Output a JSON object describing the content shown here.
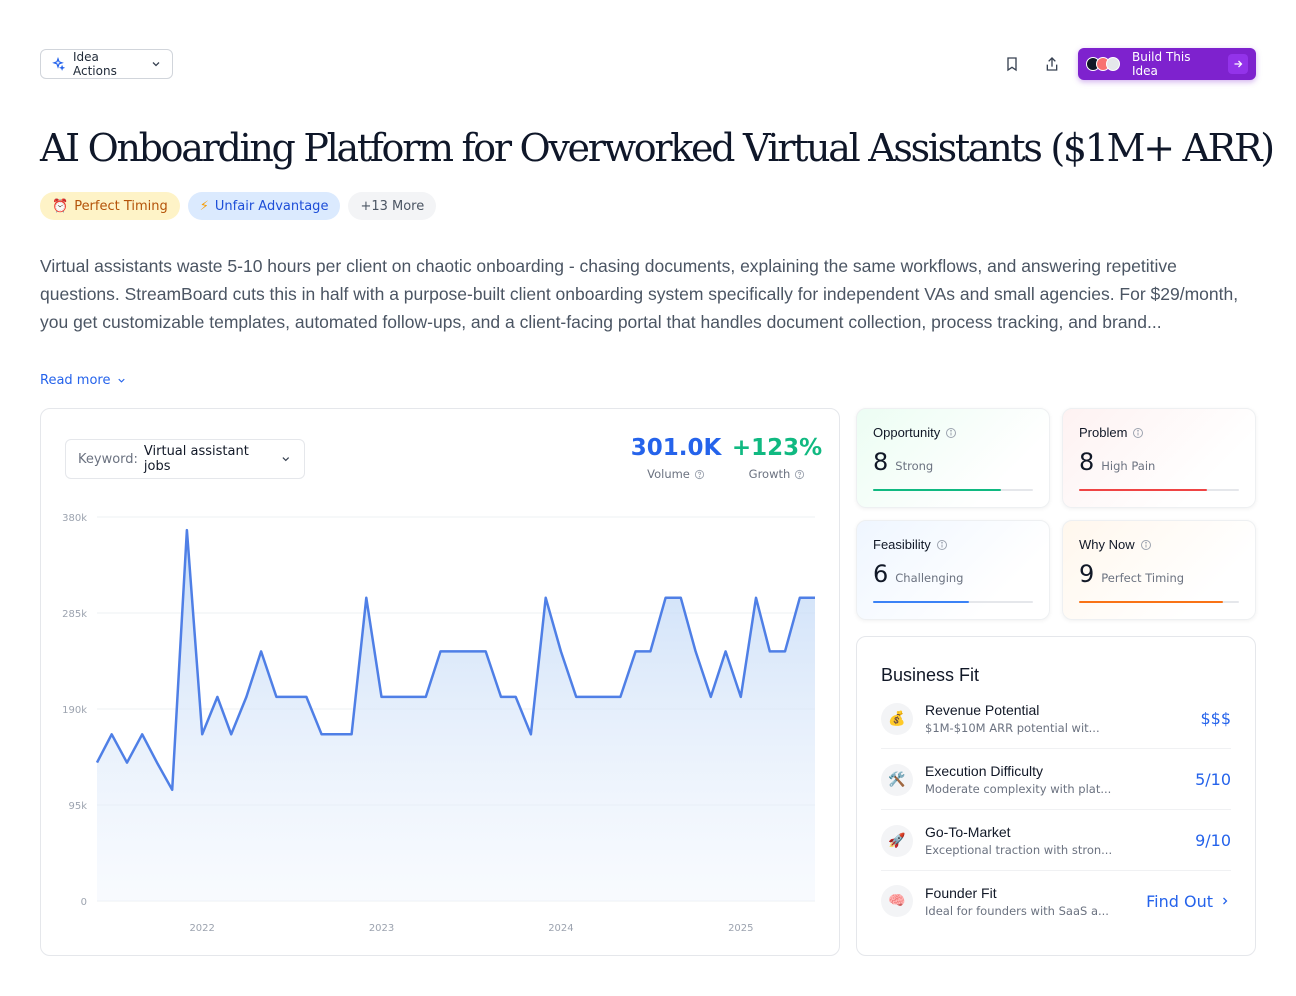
{
  "header": {
    "idea_actions_label": "Idea Actions",
    "build_label": "Build This Idea",
    "icons": [
      "sparkle-icon",
      "chevron-down-icon",
      "bookmark-icon",
      "share-icon",
      "arrow-right-icon"
    ]
  },
  "title": "AI Onboarding Platform for Overworked Virtual Assistants ($1M+ ARR)",
  "tags": [
    {
      "label": "Perfect Timing",
      "emoji": "⏰"
    },
    {
      "label": "Unfair Advantage",
      "emoji": "⚡"
    },
    {
      "label": "+13 More"
    }
  ],
  "description": "Virtual assistants waste 5-10 hours per client on chaotic onboarding - chasing documents, explaining the same workflows, and answering repetitive questions. StreamBoard cuts this in half with a purpose-built client onboarding system specifically for independent VAs and small agencies. For $29/month, you get customizable templates, automated follow-ups, and a client-facing portal that handles document collection, process tracking, and brand...",
  "read_more_label": "Read more",
  "trend": {
    "keyword_label": "Keyword:",
    "keyword_value": "Virtual assistant jobs",
    "volume_value": "301.0K",
    "volume_label": "Volume",
    "growth_value": "+123%",
    "growth_label": "Growth"
  },
  "chart_data": {
    "type": "area",
    "x_tick_labels": [
      "2022",
      "2023",
      "2024",
      "2025"
    ],
    "y_tick_labels": [
      "0",
      "95k",
      "190k",
      "285k",
      "380k"
    ],
    "ylim": [
      0,
      380000
    ],
    "x": [
      "2021-06",
      "2021-07",
      "2021-08",
      "2021-09",
      "2021-10",
      "2021-11",
      "2021-12",
      "2022-01",
      "2022-02",
      "2022-03",
      "2022-04",
      "2022-05",
      "2022-06",
      "2022-07",
      "2022-08",
      "2022-09",
      "2022-10",
      "2022-11",
      "2022-12",
      "2023-01",
      "2023-02",
      "2023-03",
      "2023-04",
      "2023-05",
      "2023-06",
      "2023-07",
      "2023-08",
      "2023-09",
      "2023-10",
      "2023-11",
      "2023-12",
      "2024-01",
      "2024-02",
      "2024-03",
      "2024-04",
      "2024-05",
      "2024-06",
      "2024-07",
      "2024-08",
      "2024-09",
      "2024-10",
      "2024-11",
      "2024-12",
      "2025-01",
      "2025-02",
      "2025-03",
      "2025-04",
      "2025-05",
      "2025-06"
    ],
    "series": [
      {
        "values": [
          137000,
          165000,
          137000,
          165000,
          137000,
          110000,
          367000,
          165000,
          202000,
          165000,
          202000,
          247000,
          202000,
          202000,
          202000,
          165000,
          165000,
          165000,
          300000,
          202000,
          202000,
          202000,
          202000,
          247000,
          247000,
          247000,
          247000,
          202000,
          202000,
          165000,
          300000,
          247000,
          202000,
          202000,
          202000,
          202000,
          247000,
          247000,
          300000,
          300000,
          247000,
          202000,
          247000,
          202000,
          300000,
          247000,
          247000,
          300000,
          300000
        ]
      }
    ],
    "grid": true,
    "legend": "none",
    "color": "#4f7fe6"
  },
  "scores": [
    {
      "title": "Opportunity",
      "number": "8",
      "word": "Strong",
      "value": 8,
      "color": "#10b981",
      "bg_from": "#ecfdf3"
    },
    {
      "title": "Problem",
      "number": "8",
      "word": "High Pain",
      "value": 8,
      "color": "#ef4444",
      "bg_from": "#fef2f2"
    },
    {
      "title": "Feasibility",
      "number": "6",
      "word": "Challenging",
      "value": 6,
      "color": "#3b82f6",
      "bg_from": "#eff6ff"
    },
    {
      "title": "Why Now",
      "number": "9",
      "word": "Perfect Timing",
      "value": 9,
      "color": "#f97316",
      "bg_from": "#fff7ed"
    }
  ],
  "business_fit": {
    "title": "Business Fit",
    "rows": [
      {
        "name": "Revenue Potential",
        "desc": "$1M-$10M ARR potential wit...",
        "value": "$$$",
        "emoji": "💰",
        "icon": "money-bag-icon"
      },
      {
        "name": "Execution Difficulty",
        "desc": "Moderate complexity with plat...",
        "value": "5/10",
        "emoji": "🛠️",
        "icon": "tools-icon"
      },
      {
        "name": "Go-To-Market",
        "desc": "Exceptional traction with stron...",
        "value": "9/10",
        "emoji": "🚀",
        "icon": "rocket-icon"
      },
      {
        "name": "Founder Fit",
        "desc": "Ideal for founders with SaaS a...",
        "value": "Find Out",
        "emoji": "🧠",
        "icon": "brain-icon"
      }
    ]
  }
}
